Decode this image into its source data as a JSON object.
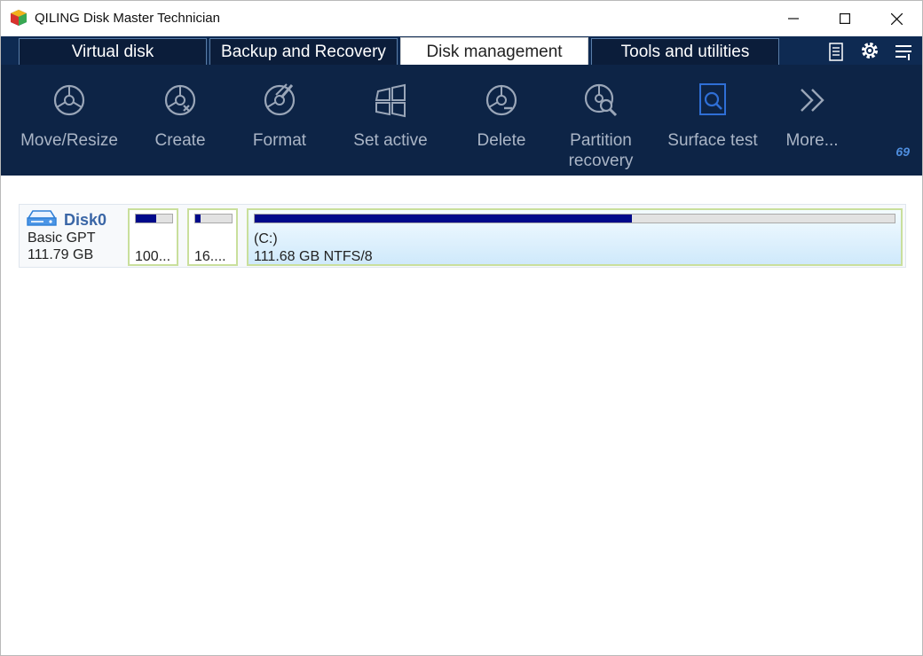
{
  "window": {
    "title": "QILING Disk Master Technician"
  },
  "tabs": [
    {
      "label": "Virtual disk",
      "active": false
    },
    {
      "label": "Backup and Recovery",
      "active": false
    },
    {
      "label": "Disk management",
      "active": true
    },
    {
      "label": "Tools and utilities",
      "active": false
    }
  ],
  "tab_tools": {
    "list_icon": "list-icon",
    "settings_icon": "gear-icon",
    "menu_icon": "menu-icon"
  },
  "ribbon": {
    "buttons": [
      {
        "label": "Move/Resize",
        "icon": "move-resize-icon"
      },
      {
        "label": "Create",
        "icon": "create-partition-icon"
      },
      {
        "label": "Format",
        "icon": "format-icon"
      },
      {
        "label": "Set active",
        "icon": "set-active-icon"
      },
      {
        "label": "Delete",
        "icon": "delete-partition-icon"
      },
      {
        "label": "Partition recovery",
        "icon": "partition-recovery-icon"
      },
      {
        "label": "Surface test",
        "icon": "surface-test-icon"
      },
      {
        "label": "More...",
        "icon": "chevron-double-right-icon"
      }
    ],
    "corner_mark": "69"
  },
  "colors": {
    "ribbon_bg": "#0d2446",
    "tab_bg": "#0b1d3a",
    "disk_name": "#3a66a6",
    "used_fill": "#000a8a",
    "partition_border": "#c9df9c"
  },
  "disk": {
    "name": "Disk0",
    "type": "Basic GPT",
    "size": "111.79 GB",
    "partitions": [
      {
        "label": "100...",
        "used_fraction": 0.55
      },
      {
        "label": "16....",
        "used_fraction": 0.15
      },
      {
        "drive": "(C:)",
        "label": "111.68 GB NTFS/8",
        "used_fraction": 0.59
      }
    ]
  }
}
